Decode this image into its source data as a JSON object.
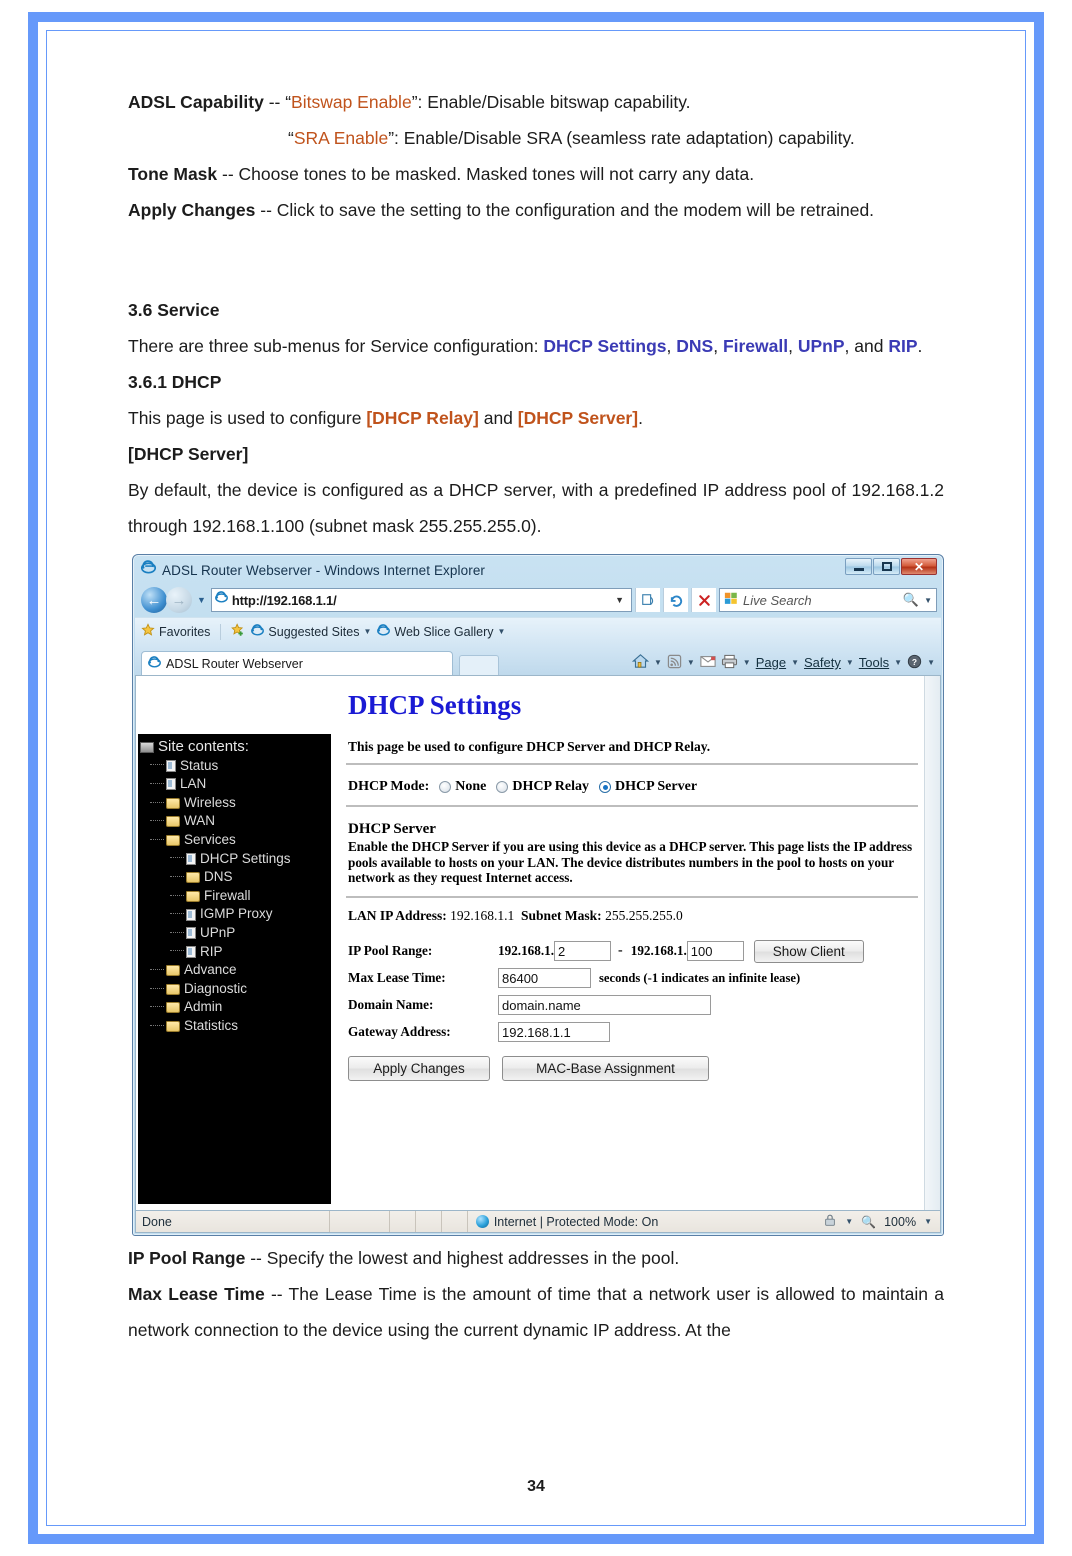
{
  "document": {
    "page_number": "34",
    "paragraphs": {
      "adsl_capability_term": "ADSL Capability",
      "adsl_capability_sep": " -- “",
      "bitswap_enable": "Bitswap Enable",
      "adsl_capability_rest": "”: Enable/Disable bitswap capability.",
      "sra_open_quote": "“",
      "sra_enable": "SRA Enable",
      "sra_rest": "”: Enable/Disable SRA (seamless rate adaptation) capability.",
      "tone_mask_term": "Tone Mask",
      "tone_mask_rest": " -- Choose tones to be masked. Masked tones will not carry any data.",
      "apply_changes_term": "Apply Changes",
      "apply_changes_rest": " -- Click to save the setting to the configuration and the modem will be retrained.",
      "section_heading": "3.6 Service",
      "service_intro_a": "There are three sub-menus for Service configuration: ",
      "service_link_1": "DHCP Settings",
      "service_link_2": "DNS",
      "service_link_3": "Firewall",
      "service_link_4": "UPnP",
      "service_intro_and": "and ",
      "service_link_5": "RIP",
      "subsection_heading": "3.6.1 DHCP",
      "configure_intro": "This page is used to configure ",
      "dhcp_relay_tag": "[DHCP Relay]",
      "configure_and": " and ",
      "dhcp_server_tag": "[DHCP Server]",
      "dhcp_server_header": "[DHCP Server]",
      "default_desc": "By default, the device is configured as a DHCP server, with a predefined IP address pool of 192.168.1.2 through 192.168.1.100 (subnet mask 255.255.255.0).",
      "ip_pool_term": "IP Pool Range",
      "ip_pool_rest": " -- Specify the lowest and highest addresses in the pool.",
      "max_lease_term": "Max Lease Time",
      "max_lease_rest": " -- The Lease Time is the amount of time that a network user is allowed to maintain a network connection to the device using the current dynamic IP address. At the"
    },
    "colors": {
      "orange": "#c0531c",
      "blue": "#3b3bb5",
      "border_blue": "#6699fa"
    }
  },
  "browser": {
    "title": "ADSL Router Webserver - Windows Internet Explorer",
    "window_buttons": {
      "minimize": "minimize-button",
      "maximize": "maximize-button",
      "close": "close-button"
    },
    "address": {
      "url": "http://192.168.1.1/",
      "icons": [
        "compatibility-view-icon",
        "refresh-icon",
        "stop-icon"
      ]
    },
    "search": {
      "placeholder": "Live Search"
    },
    "favorites_bar": {
      "favorites_label": "Favorites",
      "items": [
        "Suggested Sites",
        "Web Slice Gallery"
      ]
    },
    "tab": {
      "label": "ADSL Router Webserver"
    },
    "command_bar": {
      "items": [
        "Page",
        "Safety",
        "Tools"
      ],
      "page": "Page",
      "safety": "Safety",
      "tools": "Tools"
    },
    "status_bar": {
      "status": "Done",
      "zone": "Internet | Protected Mode: On",
      "zoom": "100%"
    }
  },
  "router_page": {
    "sidebar": {
      "root": "Site contents:",
      "items": [
        {
          "label": "Status",
          "icon": "document-icon",
          "level": 1
        },
        {
          "label": "LAN",
          "icon": "document-icon",
          "level": 1
        },
        {
          "label": "Wireless",
          "icon": "folder-icon",
          "level": 1
        },
        {
          "label": "WAN",
          "icon": "folder-icon",
          "level": 1
        },
        {
          "label": "Services",
          "icon": "folder-open-icon",
          "level": 1
        },
        {
          "label": "DHCP Settings",
          "icon": "document-icon",
          "level": 2
        },
        {
          "label": "DNS",
          "icon": "folder-icon",
          "level": 2
        },
        {
          "label": "Firewall",
          "icon": "folder-icon",
          "level": 2
        },
        {
          "label": "IGMP Proxy",
          "icon": "document-icon",
          "level": 2
        },
        {
          "label": "UPnP",
          "icon": "document-icon",
          "level": 2
        },
        {
          "label": "RIP",
          "icon": "document-icon",
          "level": 2
        },
        {
          "label": "Advance",
          "icon": "folder-icon",
          "level": 1
        },
        {
          "label": "Diagnostic",
          "icon": "folder-icon",
          "level": 1
        },
        {
          "label": "Admin",
          "icon": "folder-icon",
          "level": 1
        },
        {
          "label": "Statistics",
          "icon": "folder-icon",
          "level": 1
        }
      ]
    },
    "main": {
      "title": "DHCP Settings",
      "description": "This page be used to configure DHCP Server and DHCP Relay.",
      "dhcp_mode_label": "DHCP Mode:",
      "modes": [
        {
          "label": "None",
          "selected": false
        },
        {
          "label": "DHCP Relay",
          "selected": false
        },
        {
          "label": "DHCP Server",
          "selected": true
        }
      ],
      "server_section_title": "DHCP Server",
      "server_section_text": "Enable the DHCP Server if you are using this device as a DHCP server. This page lists the IP address pools available to hosts on your LAN. The device distributes numbers in the pool to hosts on your network as they request Internet access.",
      "lan_ip_label": "LAN IP Address:",
      "lan_ip_value": "192.168.1.1",
      "subnet_label": "Subnet Mask:",
      "subnet_value": "255.255.255.0",
      "form": {
        "ip_pool_label": "IP Pool Range:",
        "ip_prefix_start": "192.168.1.",
        "ip_pool_start": "2",
        "ip_range_dash": "-",
        "ip_prefix_end": "192.168.1.",
        "ip_pool_end": "100",
        "show_client_button": "Show Client",
        "max_lease_label": "Max Lease Time:",
        "max_lease_value": "86400",
        "max_lease_note": "seconds (-1 indicates an infinite lease)",
        "domain_label": "Domain Name:",
        "domain_value": "domain.name",
        "gateway_label": "Gateway Address:",
        "gateway_value": "192.168.1.1",
        "apply_button": "Apply Changes",
        "mac_button": "MAC-Base Assignment"
      }
    }
  }
}
